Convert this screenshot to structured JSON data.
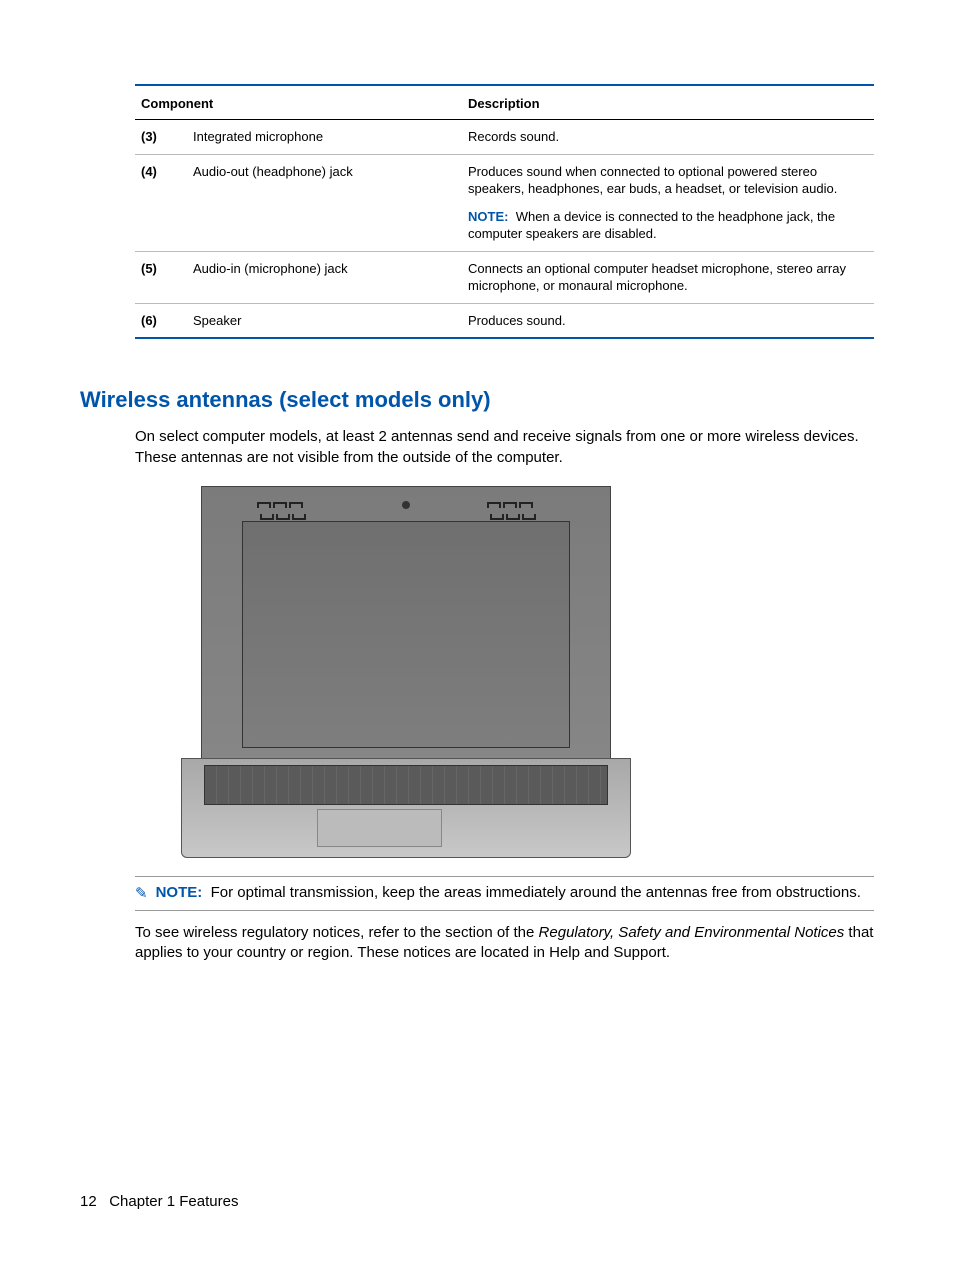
{
  "table": {
    "headers": {
      "component": "Component",
      "description": "Description"
    },
    "rows": [
      {
        "num": "(3)",
        "comp": "Integrated microphone",
        "desc": "Records sound."
      },
      {
        "num": "(4)",
        "comp": "Audio-out (headphone) jack",
        "desc": "Produces sound when connected to optional powered stereo speakers, headphones, ear buds, a headset, or television audio.",
        "note_label": "NOTE:",
        "note_text": "When a device is connected to the headphone jack, the computer speakers are disabled."
      },
      {
        "num": "(5)",
        "comp": "Audio-in (microphone) jack",
        "desc": "Connects an optional computer headset microphone, stereo array microphone, or monaural microphone."
      },
      {
        "num": "(6)",
        "comp": "Speaker",
        "desc": "Produces sound."
      }
    ]
  },
  "section_heading": "Wireless antennas (select models only)",
  "intro_text": "On select computer models, at least 2 antennas send and receive signals from one or more wireless devices. These antennas are not visible from the outside of the computer.",
  "note": {
    "label": "NOTE:",
    "text": "For optimal transmission, keep the areas immediately around the antennas free from obstructions."
  },
  "regulatory": {
    "part1": "To see wireless regulatory notices, refer to the section of the ",
    "italic": "Regulatory, Safety and Environmental Notices",
    "part2": " that applies to your country or region. These notices are located in Help and Support."
  },
  "footer": {
    "page": "12",
    "chapter": "Chapter 1   Features"
  }
}
